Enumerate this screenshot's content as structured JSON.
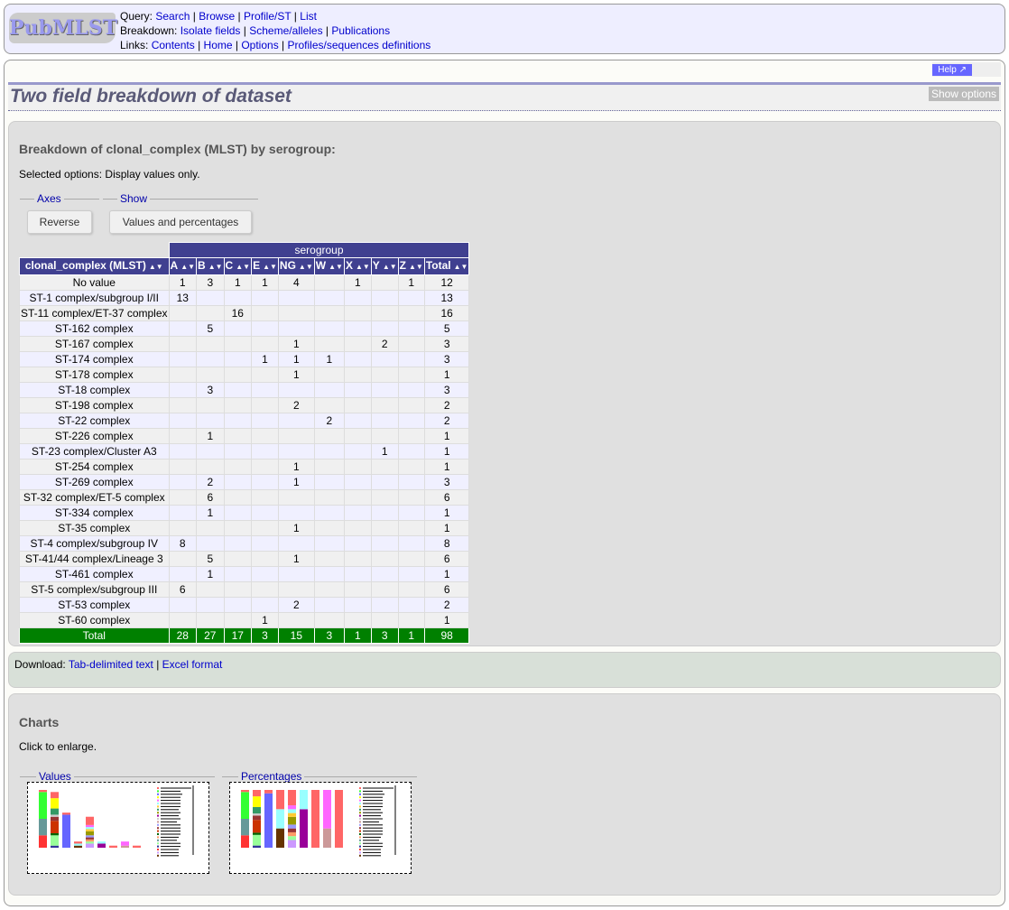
{
  "header": {
    "logo": "PubMLST",
    "query_label": "Query:",
    "query": [
      "Search",
      "Browse",
      "Profile/ST",
      "List"
    ],
    "breakdown_label": "Breakdown:",
    "breakdown": [
      "Isolate fields",
      "Scheme/alleles",
      "Publications"
    ],
    "links_label": "Links:",
    "links": [
      "Contents",
      "Home",
      "Options",
      "Profiles/sequences definitions"
    ]
  },
  "help_label": "Help",
  "page_title": "Two field breakdown of dataset",
  "show_options": "Show options",
  "breakdown": {
    "heading": "Breakdown of clonal_complex (MLST) by serogroup:",
    "selected": "Selected options: Display values only.",
    "axes_legend": "Axes",
    "reverse": "Reverse",
    "show_legend": "Show",
    "values_pct": "Values and percentages"
  },
  "table": {
    "group_header": "serogroup",
    "row_header": "clonal_complex (MLST)",
    "columns": [
      "A",
      "B",
      "C",
      "E",
      "NG",
      "W",
      "X",
      "Y",
      "Z",
      "Total"
    ],
    "rows": [
      [
        "No value",
        "1",
        "3",
        "1",
        "1",
        "4",
        "",
        "1",
        "",
        "1",
        "12"
      ],
      [
        "ST-1 complex/subgroup I/II",
        "13",
        "",
        "",
        "",
        "",
        "",
        "",
        "",
        "",
        "13"
      ],
      [
        "ST-11 complex/ET-37 complex",
        "",
        "",
        "16",
        "",
        "",
        "",
        "",
        "",
        "",
        "16"
      ],
      [
        "ST-162 complex",
        "",
        "5",
        "",
        "",
        "",
        "",
        "",
        "",
        "",
        "5"
      ],
      [
        "ST-167 complex",
        "",
        "",
        "",
        "",
        "1",
        "",
        "",
        "2",
        "",
        "3"
      ],
      [
        "ST-174 complex",
        "",
        "",
        "",
        "1",
        "1",
        "1",
        "",
        "",
        "",
        "3"
      ],
      [
        "ST-178 complex",
        "",
        "",
        "",
        "",
        "1",
        "",
        "",
        "",
        "",
        "1"
      ],
      [
        "ST-18 complex",
        "",
        "3",
        "",
        "",
        "",
        "",
        "",
        "",
        "",
        "3"
      ],
      [
        "ST-198 complex",
        "",
        "",
        "",
        "",
        "2",
        "",
        "",
        "",
        "",
        "2"
      ],
      [
        "ST-22 complex",
        "",
        "",
        "",
        "",
        "",
        "2",
        "",
        "",
        "",
        "2"
      ],
      [
        "ST-226 complex",
        "",
        "1",
        "",
        "",
        "",
        "",
        "",
        "",
        "",
        "1"
      ],
      [
        "ST-23 complex/Cluster A3",
        "",
        "",
        "",
        "",
        "",
        "",
        "",
        "1",
        "",
        "1"
      ],
      [
        "ST-254 complex",
        "",
        "",
        "",
        "",
        "1",
        "",
        "",
        "",
        "",
        "1"
      ],
      [
        "ST-269 complex",
        "",
        "2",
        "",
        "",
        "1",
        "",
        "",
        "",
        "",
        "3"
      ],
      [
        "ST-32 complex/ET-5 complex",
        "",
        "6",
        "",
        "",
        "",
        "",
        "",
        "",
        "",
        "6"
      ],
      [
        "ST-334 complex",
        "",
        "1",
        "",
        "",
        "",
        "",
        "",
        "",
        "",
        "1"
      ],
      [
        "ST-35 complex",
        "",
        "",
        "",
        "",
        "1",
        "",
        "",
        "",
        "",
        "1"
      ],
      [
        "ST-4 complex/subgroup IV",
        "8",
        "",
        "",
        "",
        "",
        "",
        "",
        "",
        "",
        "8"
      ],
      [
        "ST-41/44 complex/Lineage 3",
        "",
        "5",
        "",
        "",
        "1",
        "",
        "",
        "",
        "",
        "6"
      ],
      [
        "ST-461 complex",
        "",
        "1",
        "",
        "",
        "",
        "",
        "",
        "",
        "",
        "1"
      ],
      [
        "ST-5 complex/subgroup III",
        "6",
        "",
        "",
        "",
        "",
        "",
        "",
        "",
        "",
        "6"
      ],
      [
        "ST-53 complex",
        "",
        "",
        "",
        "",
        "2",
        "",
        "",
        "",
        "",
        "2"
      ],
      [
        "ST-60 complex",
        "",
        "",
        "",
        "1",
        "",
        "",
        "",
        "",
        "",
        "1"
      ]
    ],
    "total": [
      "Total",
      "28",
      "27",
      "17",
      "3",
      "15",
      "3",
      "1",
      "3",
      "1",
      "98"
    ]
  },
  "download": {
    "label": "Download:",
    "tab": "Tab-delimited text",
    "excel": "Excel format"
  },
  "charts": {
    "heading": "Charts",
    "hint": "Click to enlarge.",
    "values_legend": "Values",
    "pct_legend": "Percentages"
  },
  "colors": {
    "header_bg": "#404090",
    "total_bg": "#008000",
    "link": "#0000cc"
  }
}
